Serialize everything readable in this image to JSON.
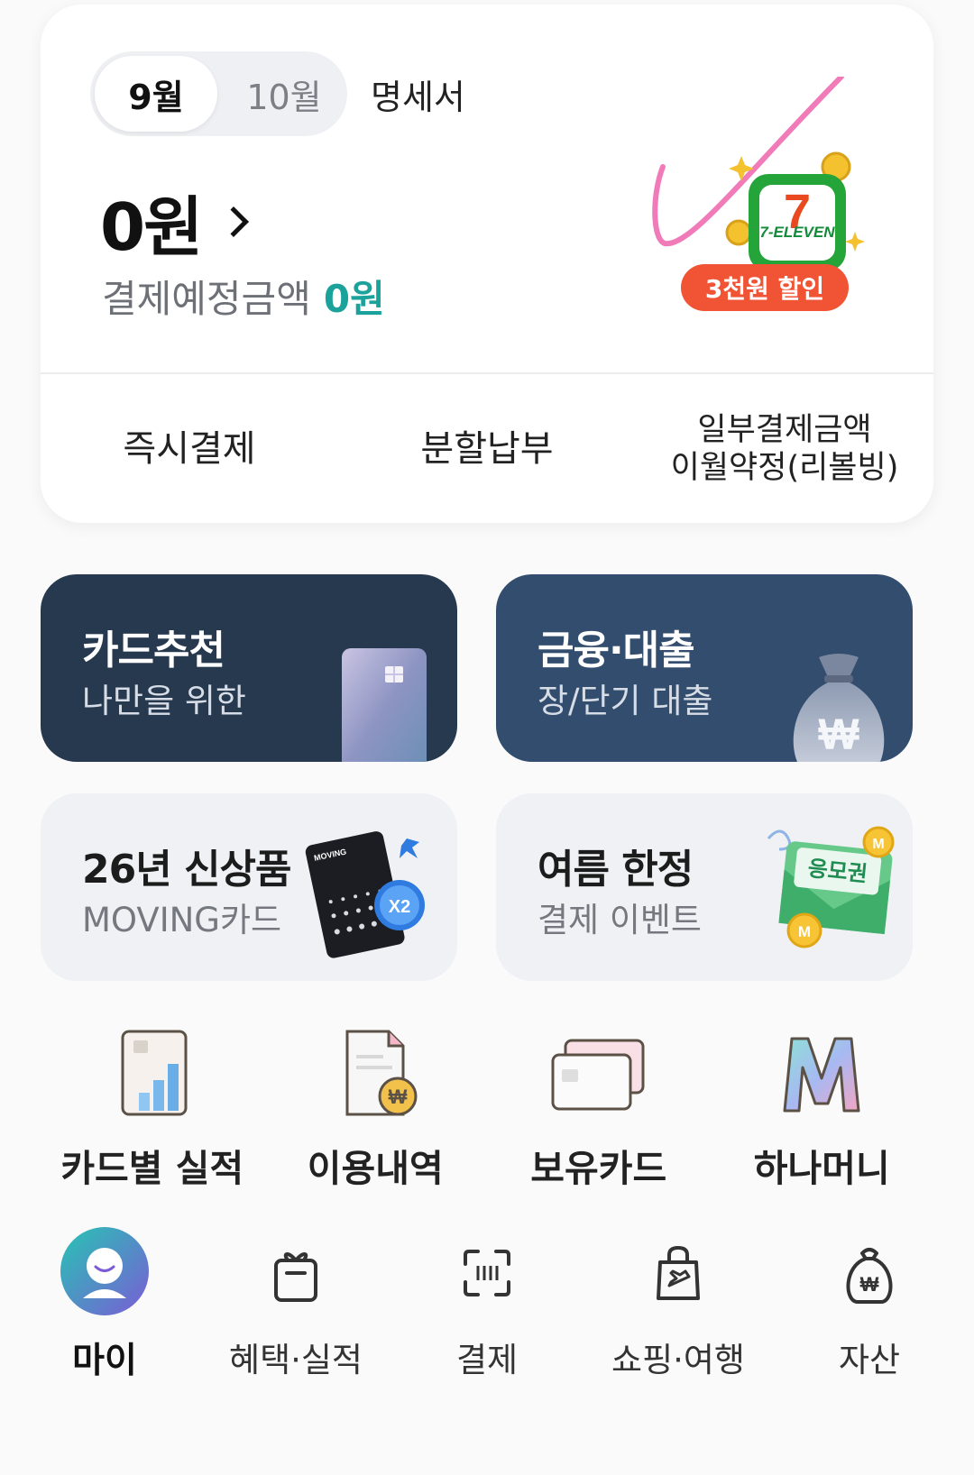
{
  "summary": {
    "months": [
      {
        "label": "9월",
        "active": true
      },
      {
        "label": "10월",
        "active": false
      }
    ],
    "statement_label": "명세서",
    "amount": "0원",
    "scheduled_label": "결제예정금액",
    "scheduled_amount": "0원",
    "scheduled_color": "#1aa29b",
    "promo": {
      "brand": "7-ELEVEN",
      "badge": "3천원 할인",
      "badge_color": "#f15434"
    },
    "actions": [
      {
        "label": "즉시결제"
      },
      {
        "label": "분할납부"
      },
      {
        "line1": "일부결제금액",
        "line2": "이월약정(리볼빙)"
      }
    ]
  },
  "tiles": [
    {
      "title": "카드추천",
      "subtitle": "나만을 위한",
      "icon": "credit-card-icon",
      "color": "#27394f"
    },
    {
      "title": "금융·대출",
      "subtitle": "장/단기 대출",
      "icon": "money-bag-icon",
      "color": "#324d6d"
    },
    {
      "title": "26년 신상품",
      "subtitle": "MOVING카드",
      "icon": "moving-card-icon",
      "card_text": "MOVING",
      "badge": "X2",
      "color": "#eff1f4"
    },
    {
      "title": "여름 한정",
      "subtitle": "결제 이벤트",
      "icon": "coupon-envelope-icon",
      "envelope_text": "응모권",
      "color": "#eff1f4"
    }
  ],
  "shortcuts": [
    {
      "label": "카드별 실적",
      "icon": "card-performance-icon"
    },
    {
      "label": "이용내역",
      "icon": "usage-history-icon"
    },
    {
      "label": "보유카드",
      "icon": "owned-cards-icon"
    },
    {
      "label": "하나머니",
      "icon": "hana-money-icon"
    }
  ],
  "bottom_nav": [
    {
      "label": "마이",
      "icon": "profile-icon",
      "active": true
    },
    {
      "label": "혜택·실적",
      "icon": "gift-icon",
      "active": false
    },
    {
      "label": "결제",
      "icon": "barcode-scan-icon",
      "active": false
    },
    {
      "label": "쇼핑·여행",
      "icon": "shopping-bag-icon",
      "active": false
    },
    {
      "label": "자산",
      "icon": "asset-pouch-icon",
      "active": false
    }
  ]
}
